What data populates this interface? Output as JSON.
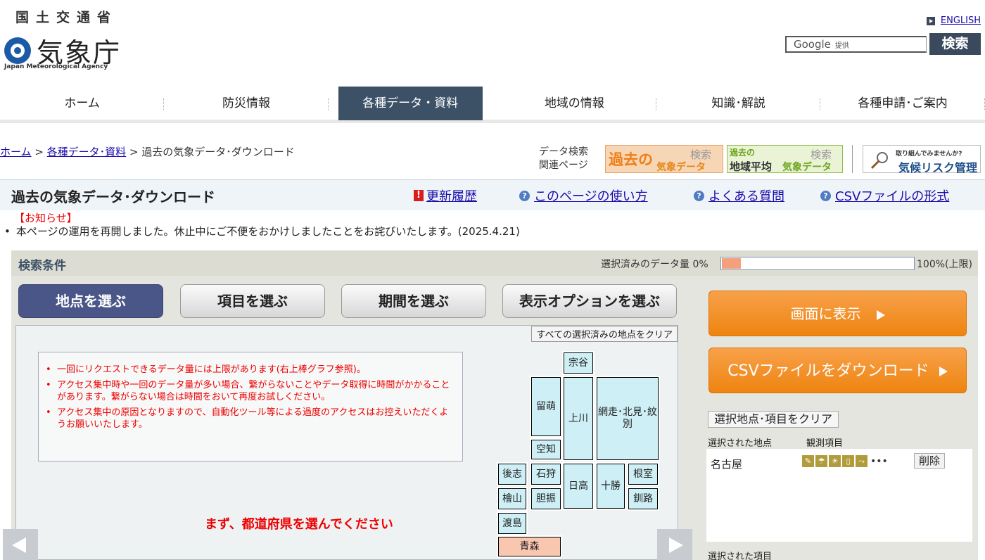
{
  "header": {
    "ministry": "国土交通省",
    "agency": "気象庁",
    "agency_en": "Japan Meteorological Agency",
    "english_link": "ENGLISH",
    "search_placeholder_main": "Google",
    "search_placeholder_sub": "提供",
    "search_button": "検索"
  },
  "gnav": {
    "items": [
      {
        "label": "ホーム"
      },
      {
        "label": "防災情報"
      },
      {
        "label": "各種データ・資料"
      },
      {
        "label": "地域の情報"
      },
      {
        "label": "知識･解説"
      },
      {
        "label": "各種申請･ご案内"
      }
    ],
    "active_index": 2
  },
  "breadcrumb": {
    "home": "ホーム",
    "sep": " > ",
    "data": "各種データ･資料",
    "current": "過去の気象データ･ダウンロード"
  },
  "related": {
    "label_line1": "データ検索",
    "label_line2": "関連ページ",
    "banner_past": {
      "big": "過去の",
      "small": "気象データ",
      "tag": "検索"
    },
    "banner_area": {
      "top": "過去の",
      "main": "地域平均",
      "small": "気象データ",
      "tag": "検索"
    },
    "banner_risk": {
      "top": "取り組んでみませんか?",
      "main": "気候リスク管理"
    }
  },
  "titlebar": {
    "title": "過去の気象データ･ダウンロード",
    "links": [
      "更新履歴",
      "このページの使い方",
      "よくある質問",
      "CSVファイルの形式"
    ]
  },
  "notice": {
    "heading": "【お知らせ】",
    "text": "本ページの運用を再開しました。休止中にご不便をおかけしましたことをお詫びいたします。(2025.4.21)"
  },
  "panel": {
    "title": "検索条件",
    "amount_label": "選択済みのデータ量 0%",
    "amount_percent": 0.1,
    "amount_limit": "100%(上限)",
    "tabs": [
      "地点を選ぶ",
      "項目を選ぶ",
      "期間を選ぶ",
      "表示オプションを選ぶ"
    ],
    "active_tab": 0,
    "clear_all": "すべての選択済みの地点をクリア",
    "notes": [
      "一回にリクエストできるデータ量には上限があります(右上棒グラフ参照)。",
      "アクセス集中時や一回のデータ量が多い場合、繋がらないことやデータ取得に時間がかかることがあります。繋がらない場合は時間をおいて再度お試しください。",
      "アクセス集中の原因となりますので、自動化ツール等による過度のアクセスはお控えいただくようお願いいたします。"
    ],
    "choose_prefecture": "まず、都道府県を選んでください",
    "regions": [
      "宗谷",
      "留萌",
      "上川",
      "網走･北見･紋別",
      "空知",
      "後志",
      "石狩",
      "日高",
      "十勝",
      "根室",
      "檜山",
      "胆振",
      "釧路",
      "渡島",
      "青森"
    ]
  },
  "right": {
    "display_button": "画面に表示",
    "csv_button": "CSVファイルをダウンロード",
    "clear_selection": "選択地点･項目をクリア",
    "label_points": "選択された地点",
    "label_observation": "観測項目",
    "station": "名古屋",
    "more": "•••",
    "delete": "削除",
    "label_items": "選択された項目"
  },
  "colors": {
    "nav_active": "#3c5066",
    "orange_button": "#ee8410",
    "region_fill": "#cdeff5",
    "region_selected": "#f9c7b0",
    "warning_red": "#e00"
  }
}
